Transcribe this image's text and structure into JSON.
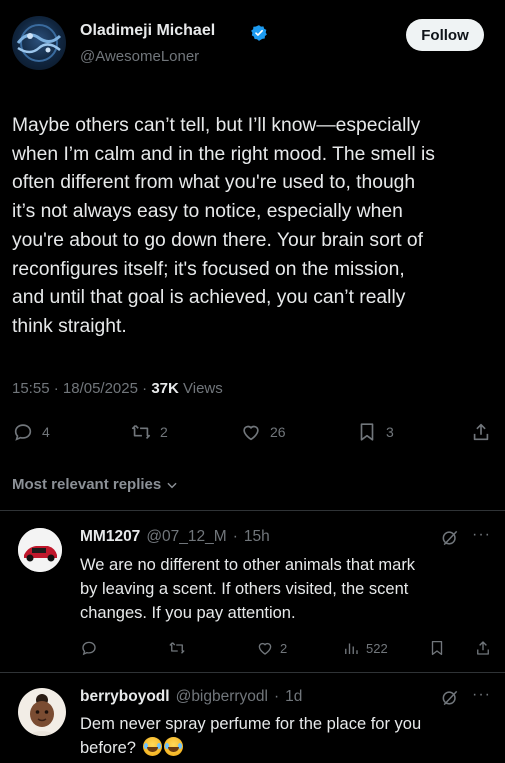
{
  "post": {
    "author_name": "Oladimeji Michael",
    "author_handle": "@AwesomeLoner",
    "follow_label": "Follow",
    "text": "Maybe others can’t tell, but I’ll know—especially\nwhen I’m calm and in the right mood. The smell is\noften different from what you're used to, though\nit’s not always easy to notice, especially when\nyou're about to go down there. Your brain sort of\nreconfigures itself; it's focused on the mission,\nand until that goal is achieved, you can’t really\nthink straight.",
    "time": "15:55",
    "date": "18/05/2025",
    "views_count": "37K",
    "views_label": "Views",
    "replies": "4",
    "reposts": "2",
    "likes": "26",
    "bookmarks": "3"
  },
  "replies_section": {
    "label": "Most relevant replies"
  },
  "replies": [
    {
      "name": "MM1207",
      "handle": "@07_12_M",
      "time": "15h",
      "text": "We are no different to other animals that mark\nby leaving a scent. If others visited, the scent\nchanges. If you pay attention.",
      "likes": "2",
      "views": "522"
    },
    {
      "name": "berryboyodl",
      "handle": "@bigberryodl",
      "time": "1d",
      "text": "Dem never spray perfume for the place for you\nbefore?"
    }
  ],
  "colors": {
    "background": "#000000",
    "text": "#e7e9ea",
    "muted": "#71767b",
    "verified": "#1d9bf0",
    "divider": "#2f3336"
  }
}
